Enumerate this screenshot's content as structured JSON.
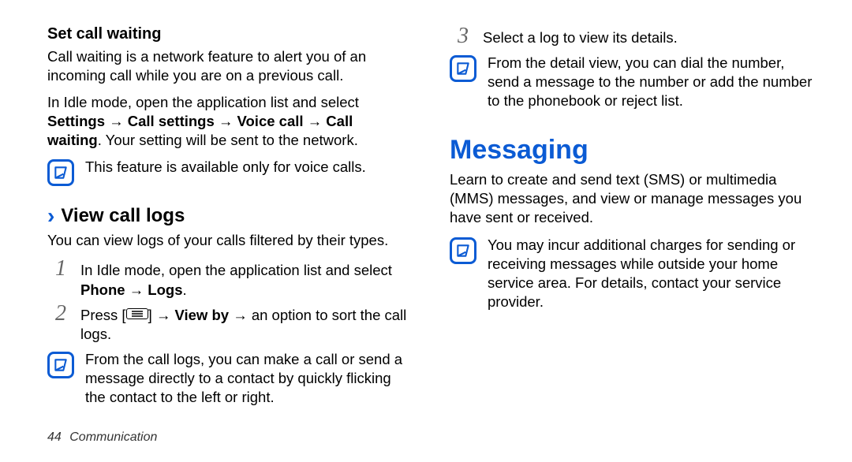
{
  "left": {
    "h1": "Set call waiting",
    "p1": "Call waiting is a network feature to alert you of an incoming call while you are on a previous call.",
    "p2_a": "In Idle mode, open the application list and select ",
    "p2_b": "Settings → Call settings → Voice call → Call waiting",
    "p2_c": ". Your setting will be sent to the network.",
    "note1": "This feature is available only for voice calls.",
    "h2": "View call logs",
    "p3": "You can view logs of your calls filtered by their types.",
    "step1_a": "In Idle mode, open the application list and select ",
    "step1_b": "Phone → Logs",
    "step1_c": ".",
    "step2_a": "Press [",
    "step2_b": "] → ",
    "step2_c": "View by",
    "step2_d": " → an option to sort the call logs.",
    "note2": "From the call logs, you can make a call or send a message directly to a contact by quickly flicking the contact to the left or right."
  },
  "right": {
    "step3": "Select a log to view its details.",
    "note3": "From the detail view, you can dial the number, send a message to the number or add the number to the phonebook or reject list.",
    "h_big": "Messaging",
    "p4": "Learn to create and send text (SMS) or multimedia (MMS) messages, and view or manage messages you have sent or received.",
    "note4": "You may incur additional charges for sending or receiving messages while outside your home service area. For details, contact your service provider."
  },
  "icons": {
    "note": "note-icon",
    "menu_key": "menu-key-icon",
    "chevron": "chevron-right-icon"
  },
  "footer": {
    "page": "44",
    "section": "Communication"
  }
}
